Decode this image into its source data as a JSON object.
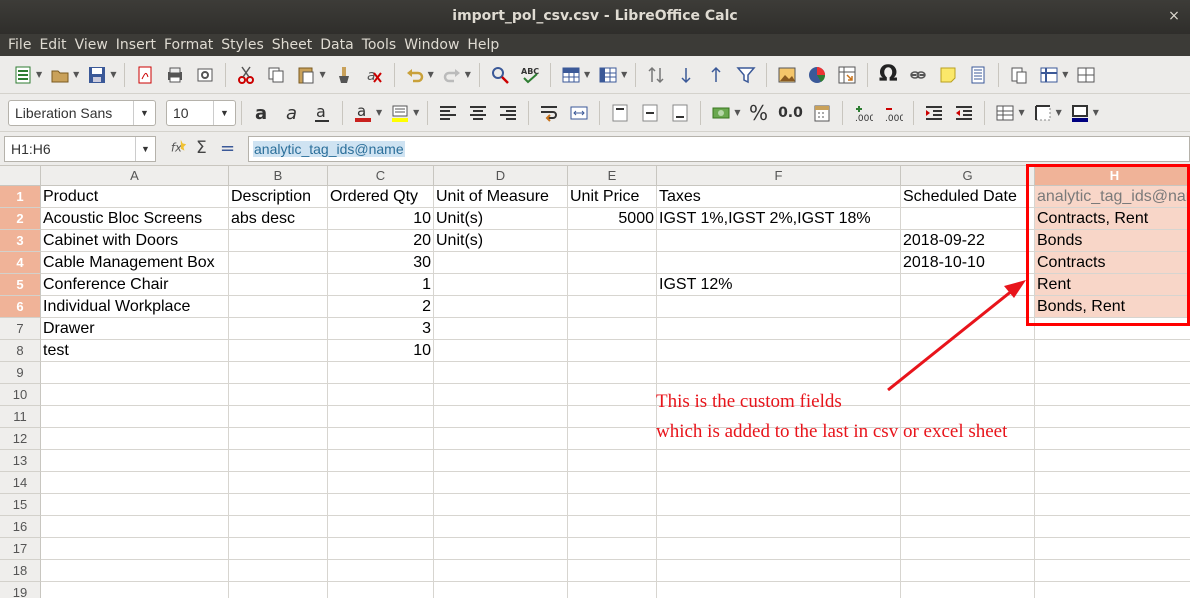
{
  "window": {
    "title": "import_pol_csv.csv - LibreOffice Calc",
    "close_glyph": "×"
  },
  "menu": [
    "File",
    "Edit",
    "View",
    "Insert",
    "Format",
    "Styles",
    "Sheet",
    "Data",
    "Tools",
    "Window",
    "Help"
  ],
  "toolbar": {
    "font_name": "Liberation Sans",
    "font_size": "10",
    "percent_label": "%",
    "decimal_label": "0.0"
  },
  "formula_bar": {
    "name_box": "H1:H6",
    "content": "analytic_tag_ids@name"
  },
  "sheet": {
    "columns": [
      "A",
      "B",
      "C",
      "D",
      "E",
      "F",
      "G",
      "H"
    ],
    "rows": [
      "1",
      "2",
      "3",
      "4",
      "5",
      "6",
      "7",
      "8",
      "9",
      "10",
      "11",
      "12",
      "13",
      "14",
      "15",
      "16",
      "17",
      "18",
      "19"
    ],
    "selected_column": "H",
    "selected_rows": [
      "1",
      "2",
      "3",
      "4",
      "5",
      "6"
    ],
    "data": [
      [
        "Product",
        "Description",
        "Ordered Qty",
        "Unit of Measure",
        "Unit Price",
        "Taxes",
        "Scheduled Date",
        "analytic_tag_ids@name"
      ],
      [
        "Acoustic Bloc Screens",
        "abs desc",
        "10",
        "Unit(s)",
        "5000",
        "IGST 1%,IGST 2%,IGST 18%",
        "",
        "Contracts, Rent"
      ],
      [
        "Cabinet with Doors",
        "",
        "20",
        "Unit(s)",
        "",
        "",
        "2018-09-22",
        "Bonds"
      ],
      [
        "Cable Management Box",
        "",
        "30",
        "",
        "",
        "",
        "2018-10-10",
        "Contracts"
      ],
      [
        "Conference Chair",
        "",
        "1",
        "",
        "",
        "IGST 12%",
        "",
        "Rent"
      ],
      [
        "Individual Workplace",
        "",
        "2",
        "",
        "",
        "",
        "",
        "Bonds, Rent"
      ],
      [
        "Drawer",
        "",
        "3",
        "",
        "",
        "",
        "",
        ""
      ],
      [
        "test",
        "",
        "10",
        "",
        "",
        "",
        "",
        ""
      ]
    ]
  },
  "annotation": {
    "line1": "This is the custom fields",
    "line2": "which is added to the last in csv or excel sheet"
  },
  "colors": {
    "highlight": "#f8d6c8",
    "header_selected": "#f0b398",
    "annotation": "#e8141b"
  }
}
